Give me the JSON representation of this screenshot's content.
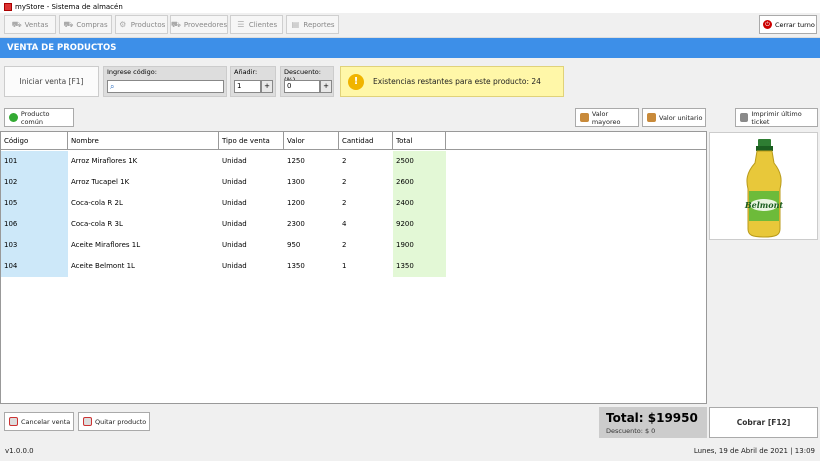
{
  "window": {
    "title": "myStore - Sistema de almacén"
  },
  "nav": {
    "items": [
      {
        "label": "Ventas",
        "icon": "cart-icon"
      },
      {
        "label": "Compras",
        "icon": "basket-icon"
      },
      {
        "label": "Productos",
        "icon": "box-icon"
      },
      {
        "label": "Proveedores",
        "icon": "truck-icon"
      },
      {
        "label": "Clientes",
        "icon": "users-icon"
      },
      {
        "label": "Reportes",
        "icon": "report-icon"
      }
    ],
    "close_label": "Cerrar turno"
  },
  "header": {
    "title": "VENTA DE PRODUCTOS"
  },
  "controls": {
    "init_label": "Iniciar venta [F1]",
    "code_label": "Ingrese código:",
    "code_value": "",
    "add_label": "Añadir:",
    "add_value": "1",
    "discount_label": "Descuento: (%)",
    "discount_value": "0",
    "stepper_plus": "+"
  },
  "info": {
    "text": "Existencias restantes para este producto: 24",
    "icon": "info-icon"
  },
  "toolbar": {
    "common_product": "Producto común",
    "wholesale": "Valor mayoreo",
    "unit_value": "Valor unitario",
    "print_last": "Imprimir último ticket"
  },
  "table": {
    "columns": [
      "Código",
      "Nombre",
      "Tipo de venta",
      "Valor",
      "Cantidad",
      "Total"
    ],
    "rows": [
      [
        "101",
        "Arroz Miraflores 1K",
        "Unidad",
        "1250",
        "2",
        "2500"
      ],
      [
        "102",
        "Arroz Tucapel 1K",
        "Unidad",
        "1300",
        "2",
        "2600"
      ],
      [
        "105",
        "Coca-cola R 2L",
        "Unidad",
        "1200",
        "2",
        "2400"
      ],
      [
        "106",
        "Coca-cola R 3L",
        "Unidad",
        "2300",
        "4",
        "9200"
      ],
      [
        "103",
        "Aceite Miraflores 1L",
        "Unidad",
        "950",
        "2",
        "1900"
      ],
      [
        "104",
        "Aceite Belmont 1L",
        "Unidad",
        "1350",
        "1",
        "1350"
      ]
    ]
  },
  "bottom": {
    "cancel": "Cancelar venta",
    "remove": "Quitar producto",
    "total": "Total: $19950",
    "discount": "Descuento:  $ 0",
    "charge": "Cobrar [F12]"
  },
  "footer": {
    "version": "v1.0.0.0",
    "datetime": "Lunes, 19 de Abril de 2021 | 13:09"
  },
  "product_image": {
    "brand": "Belmont"
  },
  "colors": {
    "header": "#3d8fe8",
    "code_col": "#cde8f9",
    "total_col": "#e3f8d6",
    "info_bg": "#fff7a8"
  }
}
